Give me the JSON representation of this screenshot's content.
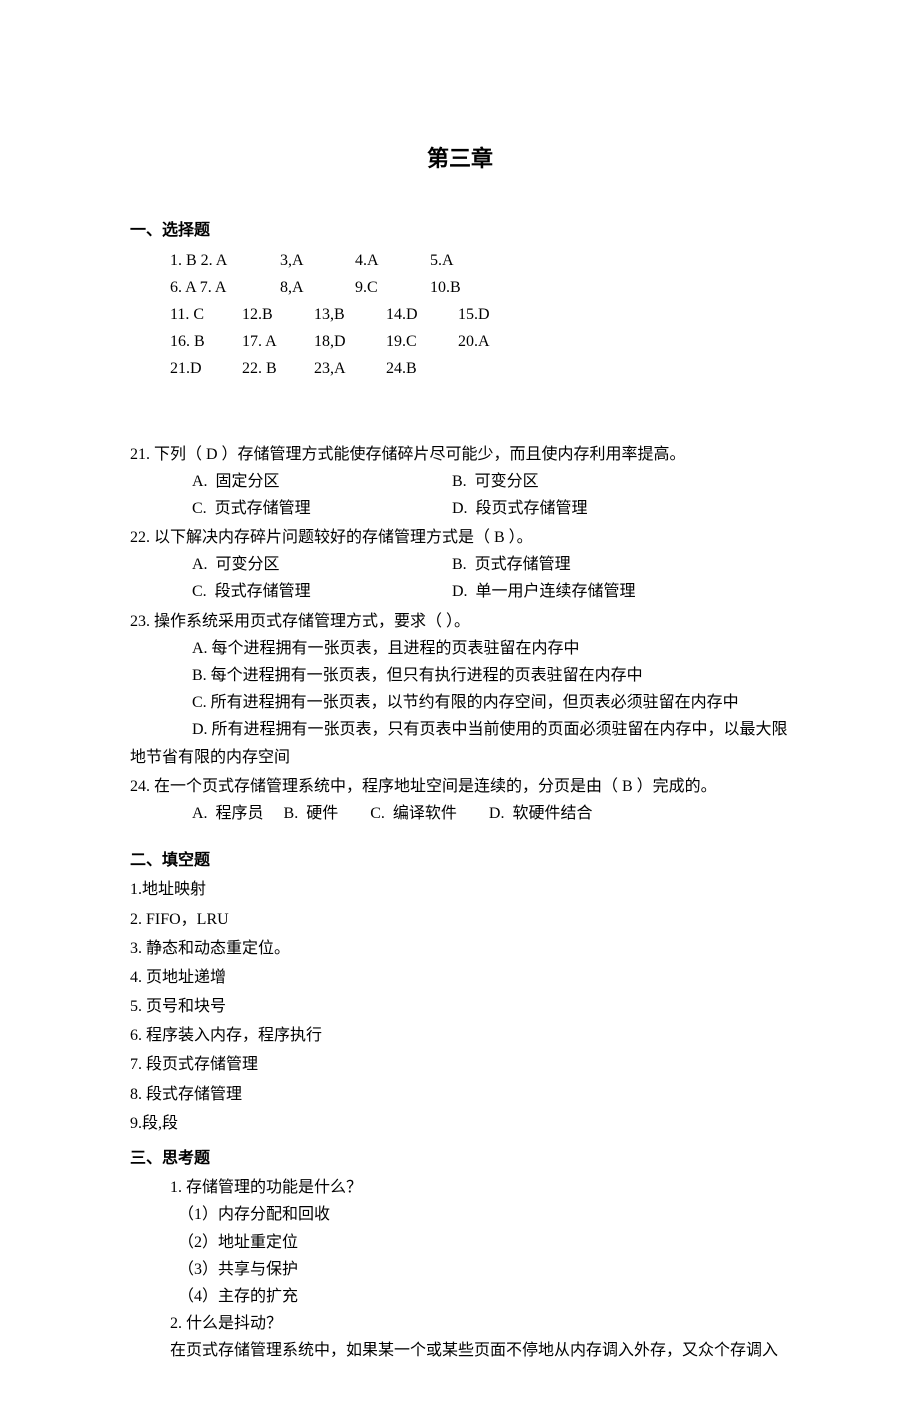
{
  "title": "第三章",
  "section1": {
    "header": "一、选择题",
    "rows": [
      [
        "1. B 2. A",
        "3,A",
        "4.A",
        "5.A",
        ""
      ],
      [
        "6. A 7. A",
        "8,A",
        "9.C",
        "10.B",
        ""
      ],
      [
        "11. C",
        "12.B",
        "13,B",
        "14.D",
        "15.D"
      ],
      [
        "16. B",
        "17. A",
        "18,D",
        "19.C",
        "20.A"
      ],
      [
        "21.D",
        "22. B",
        "23,A",
        "24.B",
        ""
      ]
    ]
  },
  "questions": [
    {
      "num": "21.",
      "stem": " 下列（  D  ）存储管理方式能使存储碎片尽可能少，而且使内存利用率提高。",
      "optsA": "A.  固定分区",
      "optsB": "B.  可变分区",
      "optsC": "C.  页式存储管理",
      "optsD": "D.  段页式存储管理"
    },
    {
      "num": "22.",
      "stem": " 以下解决内存碎片问题较好的存储管理方式是（  B  ）。",
      "optsA": "A.  可变分区",
      "optsB": "B.  页式存储管理",
      "optsC": "C.  段式存储管理",
      "optsD": "D.  单一用户连续存储管理"
    },
    {
      "num": "23.",
      "stem": " 操作系统采用页式存储管理方式，要求（     ）。",
      "linesA": "A.  每个进程拥有一张页表，且进程的页表驻留在内存中",
      "linesB": "B.  每个进程拥有一张页表，但只有执行进程的页表驻留在内存中",
      "linesC": "C.  所有进程拥有一张页表，以节约有限的内存空间，但页表必须驻留在内存中",
      "linesD1": "D.  所有进程拥有一张页表，只有页表中当前使用的页面必须驻留在内存中，以最大限",
      "linesD2": "地节省有限的内存空间"
    },
    {
      "num": "24.",
      "stem": " 在一个页式存储管理系统中，程序地址空间是连续的，分页是由（   B  ）完成的。",
      "inline": "A.  程序员     B.  硬件        C.  编译软件        D.  软硬件结合"
    }
  ],
  "section2": {
    "header": "二、填空题",
    "items": [
      "1.地址映射",
      "2. FIFO，LRU",
      "3.  静态和动态重定位。",
      "4.  页地址递增",
      "5.  页号和块号",
      "6.  程序装入内存，程序执行",
      "7.    段页式存储管理",
      "8.  段式存储管理",
      "9.段,段"
    ]
  },
  "section3": {
    "header": "三、思考题",
    "q1": {
      "stem": "1.  存储管理的功能是什么？",
      "a1": "（1）内存分配和回收",
      "a2": "（2）地址重定位",
      "a3": "（3）共享与保护",
      "a4": "（4）主存的扩充"
    },
    "q2": {
      "stem": "2.  什么是抖动？",
      "body": "在页式存储管理系统中，如果某一个或某些页面不停地从内存调入外存，又众个存调入"
    }
  }
}
